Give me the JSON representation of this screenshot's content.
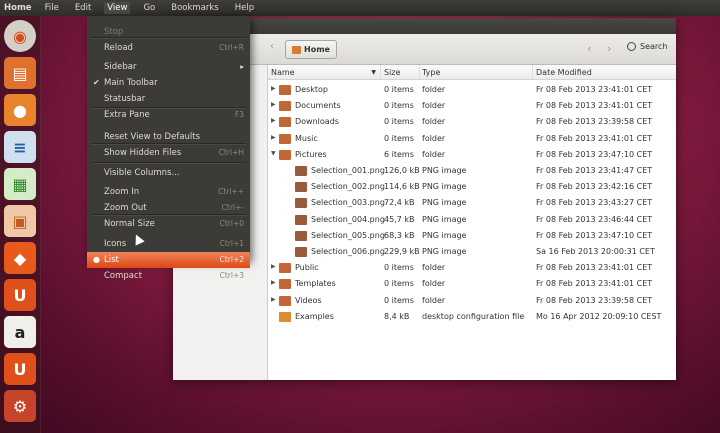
{
  "top_panel": {
    "app_name": "Home",
    "menus": [
      "File",
      "Edit",
      "View",
      "Go",
      "Bookmarks",
      "Help"
    ],
    "active_menu": "View"
  },
  "toolbar": {
    "breadcrumb": "Home",
    "search_label": "Search"
  },
  "columns": {
    "name": "Name",
    "size": "Size",
    "type": "Type",
    "modified": "Date Modified"
  },
  "files": [
    {
      "name": "Desktop",
      "size": "0 items",
      "type": "folder",
      "modified": "Fr 08 Feb 2013 23:41:01 CET",
      "icon": "folder-desktop-icon"
    },
    {
      "name": "Documents",
      "size": "0 items",
      "type": "folder",
      "modified": "Fr 08 Feb 2013 23:41:01 CET",
      "icon": "folder-documents-icon"
    },
    {
      "name": "Downloads",
      "size": "0 items",
      "type": "folder",
      "modified": "Fr 08 Feb 2013 23:39:58 CET",
      "icon": "folder-downloads-icon"
    },
    {
      "name": "Music",
      "size": "0 items",
      "type": "folder",
      "modified": "Fr 08 Feb 2013 23:41:01 CET",
      "icon": "folder-music-icon"
    },
    {
      "name": "Pictures",
      "size": "6 items",
      "type": "folder",
      "modified": "Fr 08 Feb 2013 23:47:10 CET",
      "icon": "folder-pictures-icon"
    },
    {
      "name": "Selection_001.png",
      "size": "126,0 kB",
      "type": "PNG image",
      "modified": "Fr 08 Feb 2013 23:41:47 CET",
      "icon": "image-icon"
    },
    {
      "name": "Selection_002.png",
      "size": "114,6 kB",
      "type": "PNG image",
      "modified": "Fr 08 Feb 2013 23:42:16 CET",
      "icon": "image-icon"
    },
    {
      "name": "Selection_003.png",
      "size": "72,4 kB",
      "type": "PNG image",
      "modified": "Fr 08 Feb 2013 23:43:27 CET",
      "icon": "image-icon"
    },
    {
      "name": "Selection_004.png",
      "size": "45,7 kB",
      "type": "PNG image",
      "modified": "Fr 08 Feb 2013 23:46:44 CET",
      "icon": "image-icon"
    },
    {
      "name": "Selection_005.png",
      "size": "68,3 kB",
      "type": "PNG image",
      "modified": "Fr 08 Feb 2013 23:47:10 CET",
      "icon": "image-icon"
    },
    {
      "name": "Selection_006.png",
      "size": "229,9 kB",
      "type": "PNG image",
      "modified": "Sa 16 Feb 2013 20:00:31 CET",
      "icon": "image-icon"
    },
    {
      "name": "Public",
      "size": "0 items",
      "type": "folder",
      "modified": "Fr 08 Feb 2013 23:41:01 CET",
      "icon": "folder-public-icon"
    },
    {
      "name": "Templates",
      "size": "0 items",
      "type": "folder",
      "modified": "Fr 08 Feb 2013 23:41:01 CET",
      "icon": "folder-templates-icon"
    },
    {
      "name": "Videos",
      "size": "0 items",
      "type": "folder",
      "modified": "Fr 08 Feb 2013 23:39:58 CET",
      "icon": "folder-videos-icon"
    },
    {
      "name": "Examples",
      "size": "8,4 kB",
      "type": "desktop configuration file",
      "modified": "Mo 16 Apr 2012 20:09:10 CEST",
      "icon": "examples-icon"
    }
  ],
  "view_menu": [
    {
      "label": "Stop",
      "accel": "",
      "disabled": true
    },
    {
      "label": "Reload",
      "accel": "Ctrl+R"
    },
    {
      "label": "Sidebar",
      "accel": "",
      "submenu": true
    },
    {
      "label": "Main Toolbar",
      "accel": "",
      "checked": true
    },
    {
      "label": "Statusbar",
      "accel": ""
    },
    {
      "label": "Extra Pane",
      "accel": "F3"
    },
    {
      "label": "Reset View to Defaults",
      "accel": ""
    },
    {
      "label": "Show Hidden Files",
      "accel": "Ctrl+H"
    },
    {
      "label": "Visible Columns...",
      "accel": ""
    },
    {
      "label": "Zoom In",
      "accel": "Ctrl++"
    },
    {
      "label": "Zoom Out",
      "accel": "Ctrl+-"
    },
    {
      "label": "Normal Size",
      "accel": "Ctrl+0"
    },
    {
      "label": "Icons",
      "accel": "Ctrl+1"
    },
    {
      "label": "List",
      "accel": "Ctrl+2",
      "highlighted": true,
      "radio": true
    },
    {
      "label": "Compact",
      "accel": "Ctrl+3"
    }
  ],
  "colors": {
    "accent": "#dd4814",
    "panel": "#3c3b37",
    "folder": "#d97a30"
  }
}
